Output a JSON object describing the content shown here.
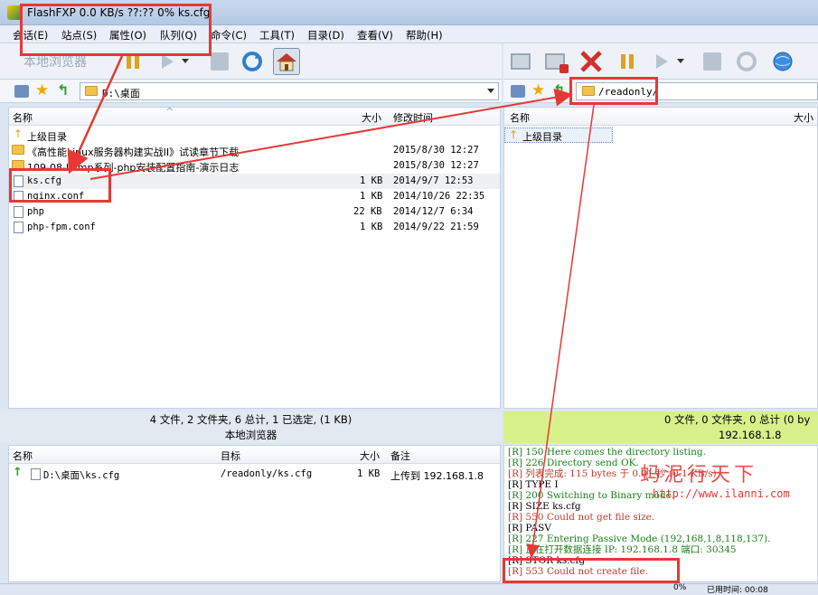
{
  "title": "FlashFXP 0.0 KB/s ??:?? 0% ks.cfg",
  "menu": [
    "会话(E)",
    "站点(S)",
    "属性(O)",
    "队列(Q)",
    "命令(C)",
    "工具(T)",
    "目录(D)",
    "查看(V)",
    "帮助(H)"
  ],
  "left": {
    "toolbar_label": "本地浏览器",
    "path": "D:\\桌面",
    "columns": {
      "name": "名称",
      "size": "大小",
      "time": "修改时间"
    },
    "rows": [
      {
        "name": "上级目录",
        "size": "",
        "time": ""
      },
      {
        "name": "《高性能Linux服务器构建实战II》试读章节下载",
        "size": "",
        "time": "2015/8/30 12:27"
      },
      {
        "name": "109-08-Lamp系列-php安装配置指南-演示日志",
        "size": "",
        "time": "2015/8/30 12:27"
      },
      {
        "name": "ks.cfg",
        "size": "1 KB",
        "time": "2014/9/7 12:53"
      },
      {
        "name": "nginx.conf",
        "size": "1 KB",
        "time": "2014/10/26 22:35"
      },
      {
        "name": "php",
        "size": "22 KB",
        "time": "2014/12/7 6:34"
      },
      {
        "name": "php-fpm.conf",
        "size": "1 KB",
        "time": "2014/9/22 21:59"
      }
    ],
    "status": "4 文件, 2 文件夹, 6 总计, 1 已选定, (1 KB)",
    "location": "本地浏览器"
  },
  "right": {
    "path": "/readonly/",
    "columns": {
      "name": "名称",
      "size": "大小"
    },
    "rows": [
      {
        "name": "上级目录"
      }
    ],
    "status": "0 文件, 0 文件夹, 0 总计 (0 by",
    "location": "192.168.1.8"
  },
  "queue": {
    "columns": {
      "name": "名称",
      "target": "目标",
      "size": "大小",
      "note": "备注"
    },
    "rows": [
      {
        "name": "D:\\桌面\\ks.cfg",
        "target": "/readonly/ks.cfg",
        "size": "1 KB",
        "note": "上传到 192.168.1.8"
      }
    ]
  },
  "log": [
    "[R] 150 Here comes the directory listing.",
    "[R] 226 Directory send OK.",
    "[R] 列表完成: 115 bytes 于 0.01 秒 (0.1 KB/s)",
    "[R] TYPE I",
    "[R] 200 Switching to Binary mode.",
    "[R] SIZE ks.cfg",
    "[R] 550 Could not get file size.",
    "[R] PASV",
    "[R] 227 Entering Passive Mode (192,168,1,8,118,137).",
    "[R] 正在打开数据连接 IP: 192.168.1.8 端口: 30345",
    "[R] STOR ks.cfg",
    "[R] 553 Could not create file."
  ],
  "bottom_status": {
    "percent": "0%",
    "elapsed": "已用时间: 00:08"
  },
  "watermark": {
    "text": "蚂泥行天下",
    "url": "http://www.ilanni.com"
  },
  "colors": {
    "accent_red": "#e53935",
    "status_green": "#d7f08a",
    "log_green": "#1a7f1a",
    "log_red": "#c0392b"
  }
}
